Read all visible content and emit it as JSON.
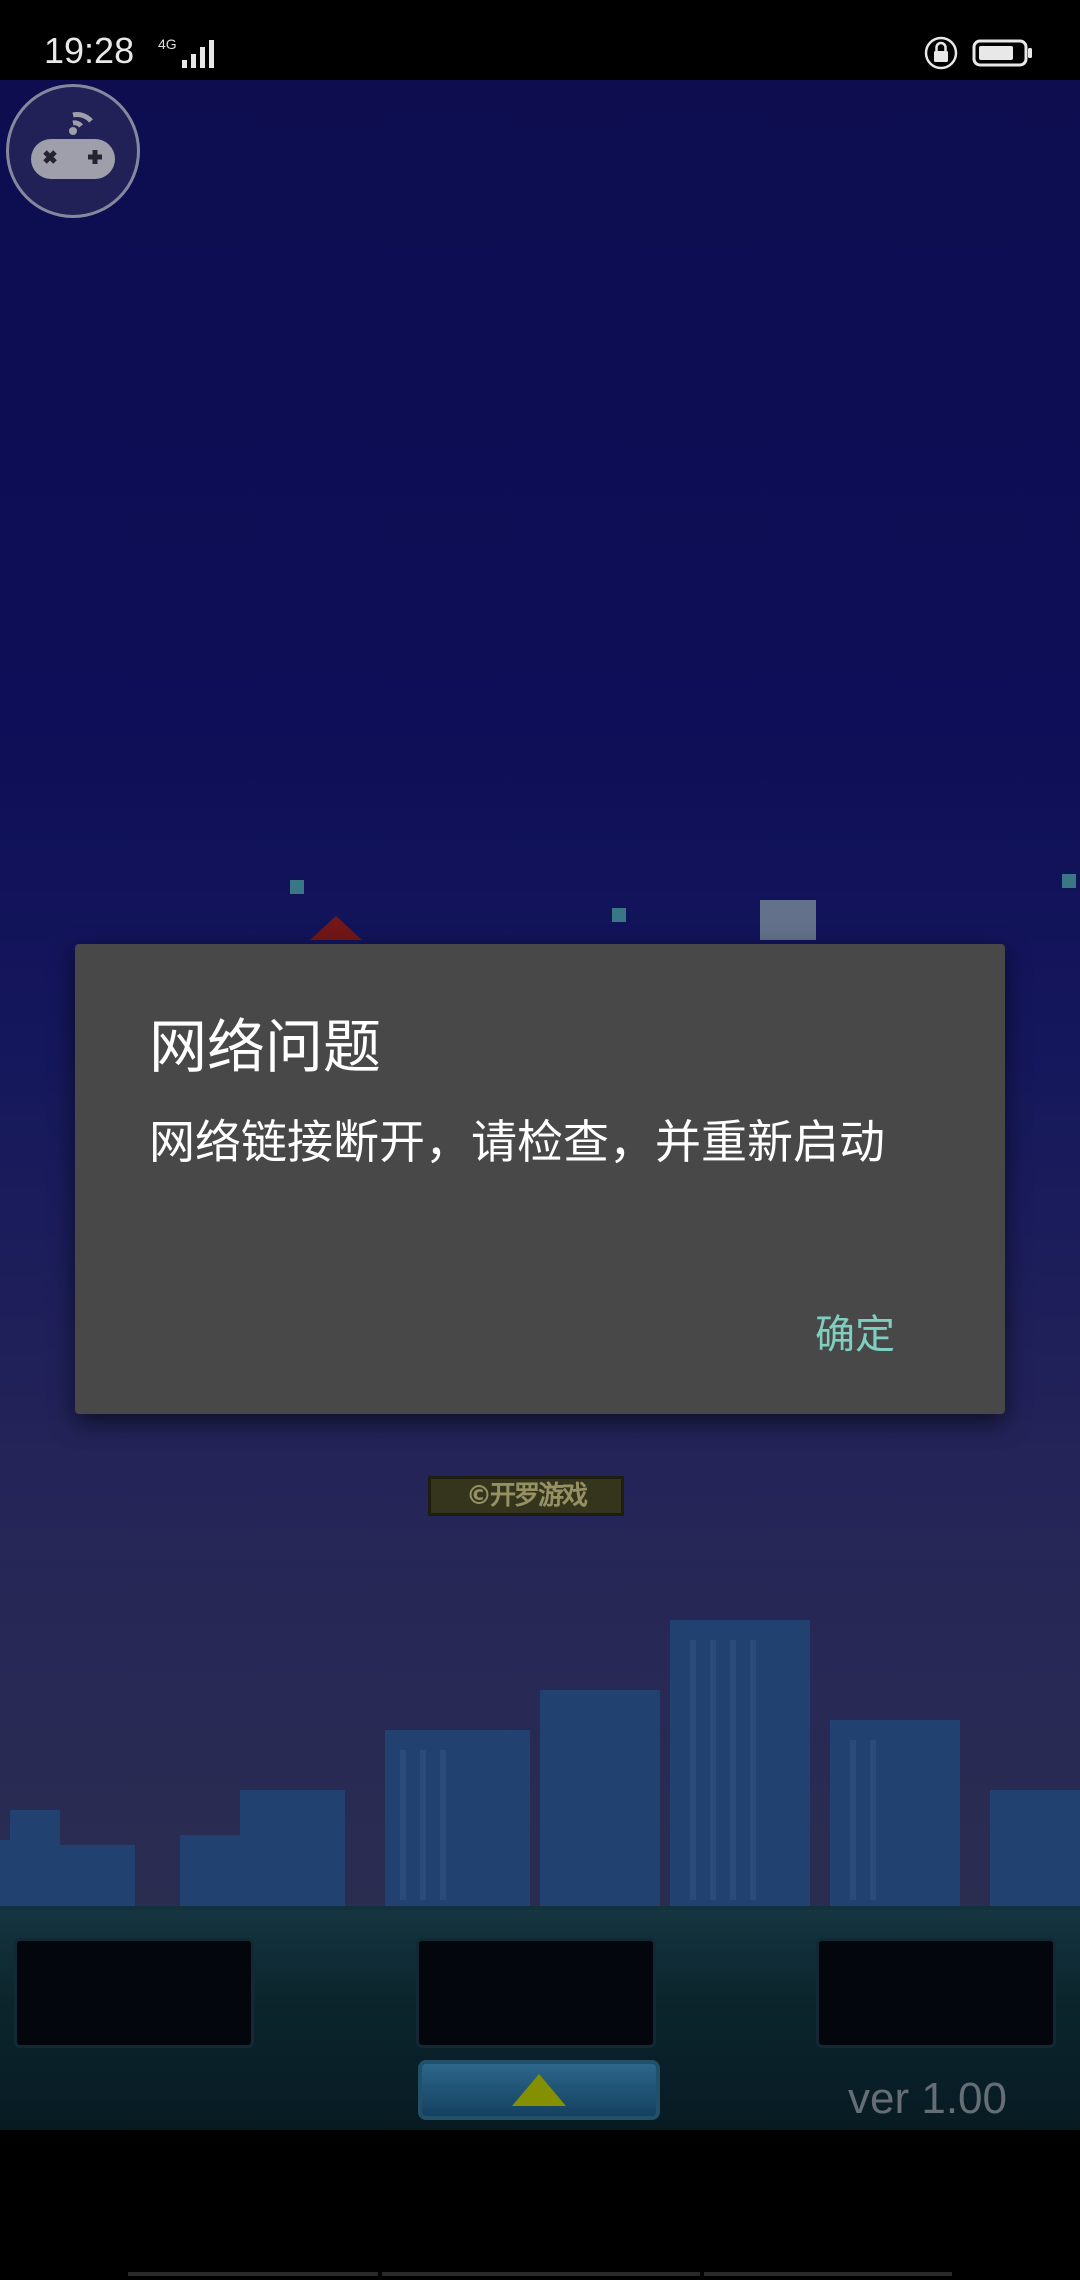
{
  "status_bar": {
    "time": "19:28",
    "network": "4G",
    "icons": [
      "signal-icon",
      "screen-lock-icon",
      "battery-icon"
    ]
  },
  "game": {
    "logo_text": "©开罗游戏",
    "version": "ver 1.00",
    "icons": [
      "gamepad-icon",
      "up-arrow-icon"
    ],
    "colors": {
      "sky": "#14147a",
      "panel": "#10343f",
      "arrow": "#b8c800"
    }
  },
  "dialog": {
    "title": "网络问题",
    "message": "网络链接断开，请检查，并重新启动",
    "ok_label": "确定",
    "accent": "#7fcfc0"
  }
}
